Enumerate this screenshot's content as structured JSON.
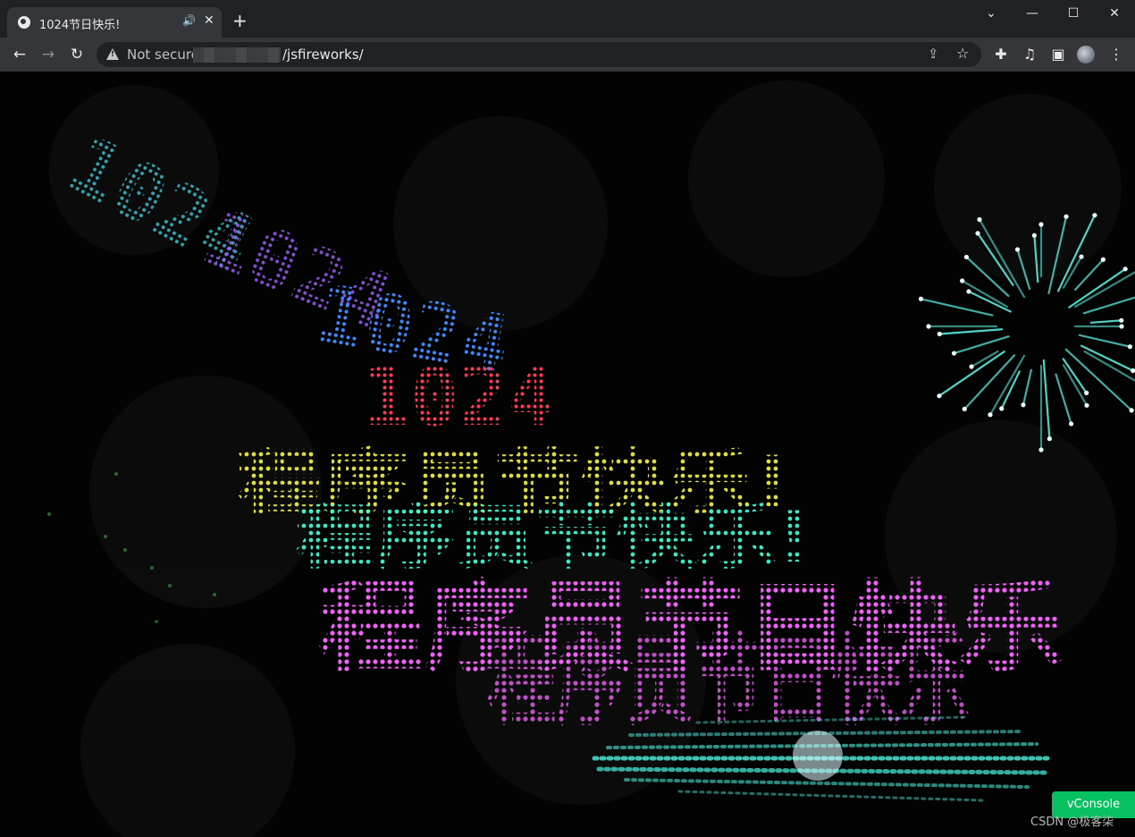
{
  "browser": {
    "tab": {
      "title": "1024节日快乐!",
      "favicon": "globe-icon",
      "audio_icon": "speaker-icon",
      "close_glyph": "✕"
    },
    "new_tab_glyph": "+",
    "window_controls": {
      "tabsearch": "⌄",
      "minimize": "—",
      "maximize": "☐",
      "close": "✕"
    },
    "nav": {
      "back": "←",
      "forward": "→",
      "reload": "↻"
    },
    "address_bar": {
      "security_label": "Not secure",
      "url_path": "/jsfireworks/"
    },
    "toolbar_icons": [
      "share-icon",
      "star-icon",
      "extensions-icon",
      "media-icon",
      "sidepanel-icon",
      "profile-avatar",
      "menu-icon"
    ]
  },
  "page": {
    "firework_text": {
      "line1": "1024",
      "line2": "程序员节快乐!",
      "line3": "程序员节日快乐"
    },
    "colors": {
      "background": "#030303",
      "trail_numbers": [
        "#36d3e0",
        "#9b5cf5",
        "#2b7bff"
      ],
      "line2_gradient": [
        "#f3f84d",
        "#7cff6a",
        "#39ffd0"
      ],
      "line3": "#e653f0",
      "burst": "#5ef7e8"
    },
    "vconsole_button": "vConsole",
    "watermark": "CSDN @极客柒"
  }
}
